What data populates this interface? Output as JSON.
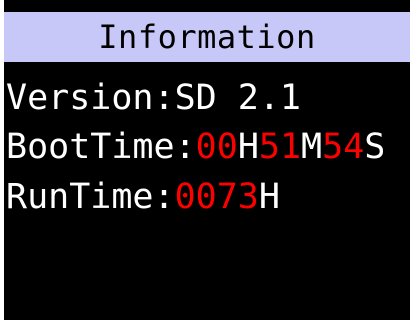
{
  "title": "Information",
  "version": {
    "label": "Version:",
    "value": "SD 2.1"
  },
  "boot_time": {
    "label": "BootTime:",
    "hours": "00",
    "hours_unit": "H",
    "minutes": "51",
    "minutes_unit": "M",
    "seconds": "54",
    "seconds_unit": "S"
  },
  "run_time": {
    "label": "RunTime:",
    "hours": "0073",
    "hours_unit": "H"
  },
  "colors": {
    "title_bar_bg": "#c8c8f8",
    "screen_bg": "#000000",
    "label_text": "#ffffff",
    "value_highlight": "#ff0000"
  }
}
